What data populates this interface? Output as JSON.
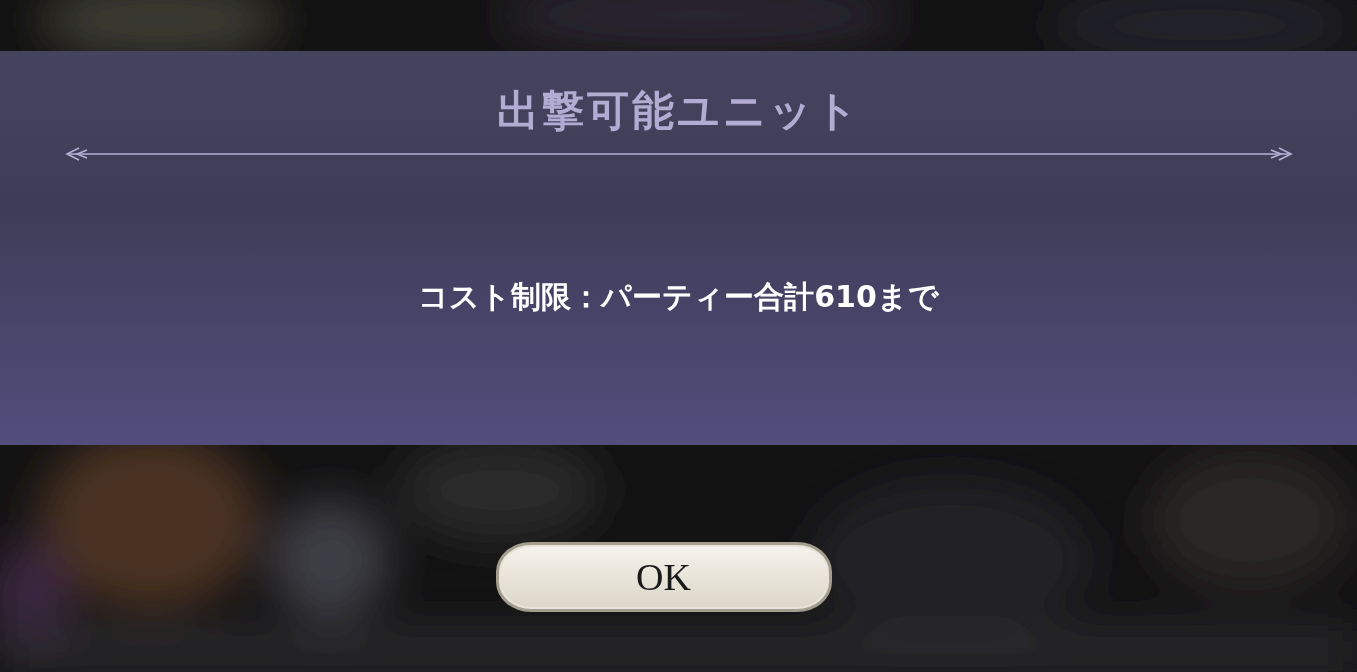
{
  "dialog": {
    "title": "出撃可能ユニット",
    "message": "コスト制限：パーティー合計610まで"
  },
  "buttons": [
    {
      "label": "OK"
    }
  ]
}
